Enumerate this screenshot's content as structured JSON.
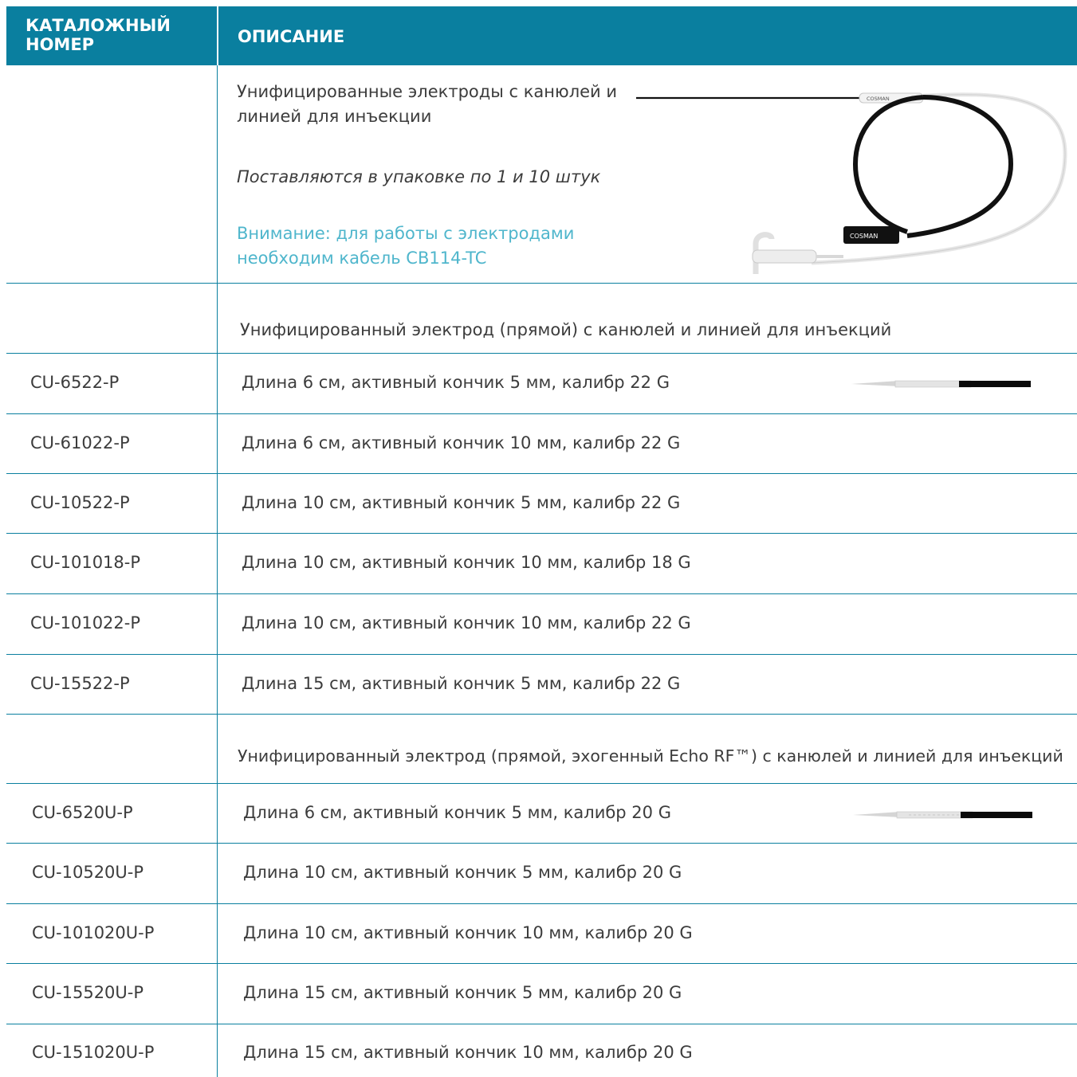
{
  "header": {
    "catalog_label": "КАТАЛОЖНЫЙ НОМЕР",
    "description_label": "ОПИСАНИЕ"
  },
  "intro": {
    "title": "Унифицированные электроды с канюлей и линией для инъекции",
    "packaging": "Поставляются в упаковке по 1 и 10 штук",
    "note": "Внимание: для работы с электродами необходим кабель CB114-TC",
    "brand_label_1": "COSMAN",
    "brand_label_2": "COSMAN"
  },
  "groups": [
    {
      "title": "Унифицированный электрод (прямой) с канюлей и линией для инъекций",
      "rows": [
        {
          "code": "CU-6522-P",
          "desc": "Длина 6 см, активный кончик 5 мм, калибр 22 G"
        },
        {
          "code": "CU-61022-P",
          "desc": "Длина 6 см, активный кончик 10 мм, калибр 22 G"
        },
        {
          "code": "CU-10522-P",
          "desc": "Длина 10 см, активный кончик 5 мм, калибр 22 G"
        },
        {
          "code": "CU-101018-P",
          "desc": "Длина 10 см, активный кончик 10 мм, калибр 18 G"
        },
        {
          "code": "CU-101022-P",
          "desc": "Длина 10 см, активный кончик 10 мм, калибр 22 G"
        },
        {
          "code": "CU-15522-P",
          "desc": "Длина 15 см, активный кончик 5 мм, калибр 22 G"
        }
      ]
    },
    {
      "title": "Унифицированный электрод (прямой, эхогенный Echo RF™) с канюлей и линией для инъекций",
      "rows": [
        {
          "code": "CU-6520U-P",
          "desc": "Длина 6 см, активный кончик 5 мм, калибр 20 G"
        },
        {
          "code": "CU-10520U-P",
          "desc": "Длина 10 см, активный кончик 5 мм, калибр 20 G"
        },
        {
          "code": "CU-101020U-P",
          "desc": "Длина 10 см, активный кончик 10 мм, калибр 20 G"
        },
        {
          "code": "CU-15520U-P",
          "desc": "Длина 15 см, активный кончик 5 мм, калибр 20 G"
        },
        {
          "code": "CU-151020U-P",
          "desc": "Длина 15 см, активный кончик 10 мм, калибр 20 G"
        }
      ]
    }
  ],
  "colors": {
    "header_bg": "#0a7f9f",
    "note_text": "#4fb6cc",
    "body_text": "#3c3c3c"
  }
}
